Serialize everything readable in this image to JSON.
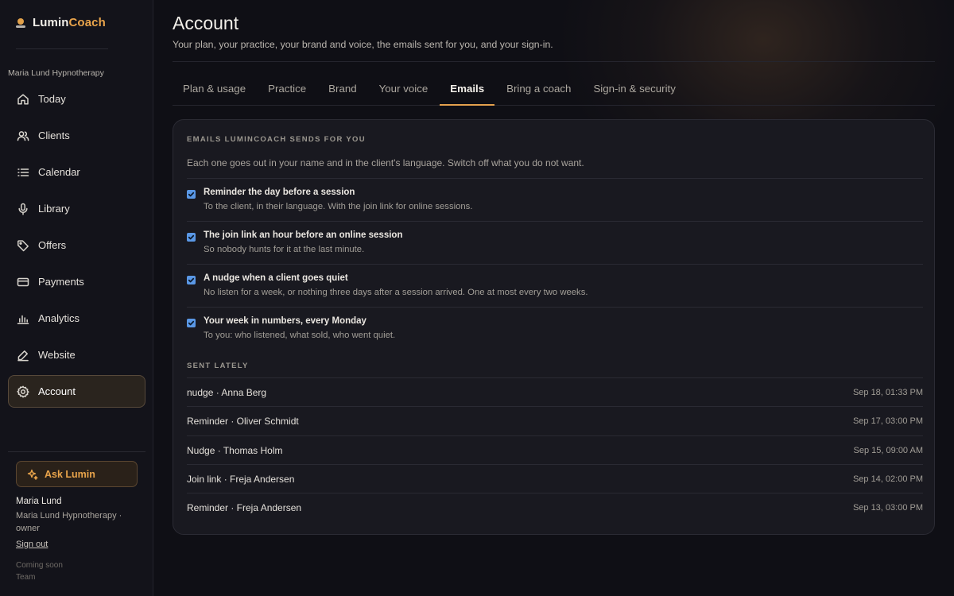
{
  "app": {
    "name_part1": "Lumin",
    "name_part2": "Coach",
    "accent": "#e9a44b"
  },
  "sidebar": {
    "practice": "Maria Lund Hypnotherapy",
    "items": [
      {
        "label": "Today",
        "icon": "home-icon"
      },
      {
        "label": "Clients",
        "icon": "users-icon"
      },
      {
        "label": "Calendar",
        "icon": "list-icon"
      },
      {
        "label": "Library",
        "icon": "microphone-icon"
      },
      {
        "label": "Offers",
        "icon": "tag-icon"
      },
      {
        "label": "Payments",
        "icon": "credit-card-icon"
      },
      {
        "label": "Analytics",
        "icon": "bar-chart-icon"
      },
      {
        "label": "Website",
        "icon": "pen-icon"
      },
      {
        "label": "Account",
        "icon": "gear-icon",
        "active": true
      }
    ],
    "ask_label": "Ask Lumin",
    "user_name": "Maria Lund",
    "user_role": "Maria Lund Hypnotherapy · owner",
    "sign_out": "Sign out",
    "coming_soon": "Coming soon",
    "team": "Team"
  },
  "header": {
    "title": "Account",
    "subtitle": "Your plan, your practice, your brand and voice, the emails sent for you, and your sign-in."
  },
  "tabs": [
    {
      "label": "Plan & usage"
    },
    {
      "label": "Practice"
    },
    {
      "label": "Brand"
    },
    {
      "label": "Your voice"
    },
    {
      "label": "Emails",
      "active": true
    },
    {
      "label": "Bring a coach"
    },
    {
      "label": "Sign-in & security"
    }
  ],
  "emails": {
    "section_title": "EMAILS LUMINCOACH SENDS FOR YOU",
    "intro": "Each one goes out in your name and in the client's language. Switch off what you do not want.",
    "options": [
      {
        "title": "Reminder the day before a session",
        "description": "To the client, in their language. With the join link for online sessions.",
        "checked": true
      },
      {
        "title": "The join link an hour before an online session",
        "description": "So nobody hunts for it at the last minute.",
        "checked": true
      },
      {
        "title": "A nudge when a client goes quiet",
        "description": "No listen for a week, or nothing three days after a session arrived. One at most every two weeks.",
        "checked": true
      },
      {
        "title": "Your week in numbers, every Monday",
        "description": "To you: who listened, what sold, who went quiet.",
        "checked": true
      }
    ],
    "sent_title": "SENT LATELY",
    "sent": [
      {
        "label": "nudge · Anna Berg",
        "date": "Sep 18, 01:33 PM"
      },
      {
        "label": "Reminder · Oliver Schmidt",
        "date": "Sep 17, 03:00 PM"
      },
      {
        "label": "Nudge · Thomas Holm",
        "date": "Sep 15, 09:00 AM"
      },
      {
        "label": "Join link · Freja Andersen",
        "date": "Sep 14, 02:00 PM"
      },
      {
        "label": "Reminder · Freja Andersen",
        "date": "Sep 13, 03:00 PM"
      }
    ]
  }
}
